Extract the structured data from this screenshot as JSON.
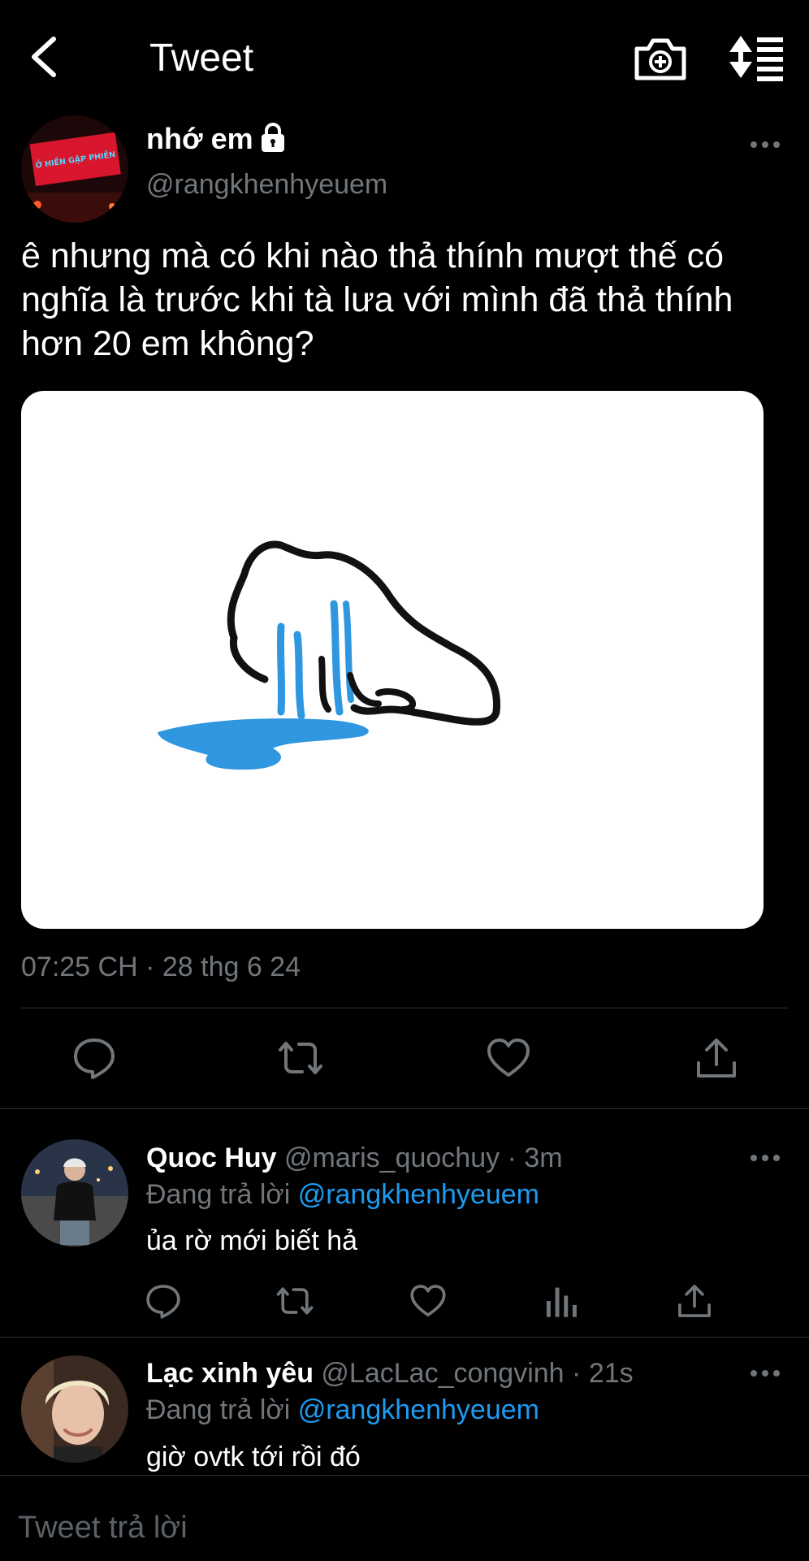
{
  "header": {
    "title": "Tweet"
  },
  "tweet": {
    "author_name": "nhớ em",
    "author_handle": "@rangkhenhyeuem",
    "avatar_sign_text": "Ở HIỀN GẶP PHIỀN",
    "text": "ê nhưng mà có khi nào thả thính mượt thế có nghĩa là trước khi tà lưa với mình đã thả thính hơn 20 em không?",
    "time": "07:25 CH · 28 thg 6 24"
  },
  "replies": [
    {
      "name": "Quoc Huy",
      "handle": "@maris_quochuy",
      "age": "3m",
      "replying_prefix": "Đang trả lời",
      "replying_to": "@rangkhenhyeuem",
      "text": "ủa rờ mới biết hả"
    },
    {
      "name": "Lạc xinh yêu",
      "handle": "@LacLac_congvinh",
      "age": "21s",
      "replying_prefix": "Đang trả lời",
      "replying_to": "@rangkhenhyeuem",
      "text": "giờ ovtk tới rồi đó"
    }
  ],
  "composer": {
    "placeholder": "Tweet trả lời"
  },
  "colors": {
    "accent": "#1d9bf0",
    "muted": "#71767b",
    "background": "#000000",
    "divider": "#2f3336"
  }
}
